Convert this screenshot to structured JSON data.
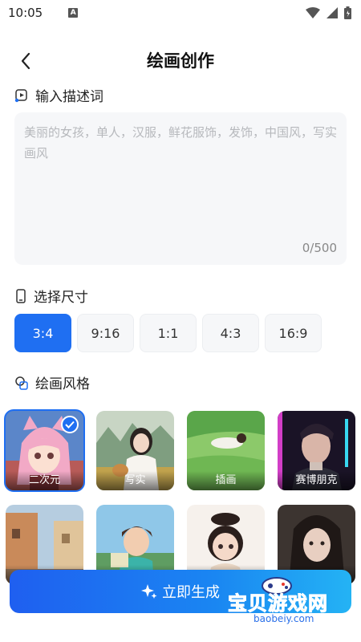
{
  "status_bar": {
    "time": "10:05",
    "notif_glyph": "A"
  },
  "header": {
    "title": "绘画创作"
  },
  "prompt": {
    "section_label": "输入描述词",
    "placeholder": "美丽的女孩，单人，汉服，鲜花服饰，发饰，中国风，写实画风",
    "value": "",
    "counter": "0/500"
  },
  "size": {
    "section_label": "选择尺寸",
    "options": [
      "3:4",
      "9:16",
      "1:1",
      "4:3",
      "16:9"
    ],
    "selected": "3:4"
  },
  "style": {
    "section_label": "绘画风格",
    "items": [
      {
        "label": "二次元",
        "selected": true
      },
      {
        "label": "写实",
        "selected": false
      },
      {
        "label": "插画",
        "selected": false
      },
      {
        "label": "赛博朋克",
        "selected": false
      },
      {
        "label": "",
        "selected": false
      },
      {
        "label": "",
        "selected": false
      },
      {
        "label": "",
        "selected": false
      },
      {
        "label": "",
        "selected": false
      }
    ]
  },
  "generate_button": {
    "label": "立即生成"
  },
  "watermark": {
    "text": "宝贝游戏网",
    "url": "baobeiy.com"
  },
  "colors": {
    "accent": "#1f6ff2",
    "input_bg": "#f6f7f9",
    "watermark": "#f7b400"
  }
}
